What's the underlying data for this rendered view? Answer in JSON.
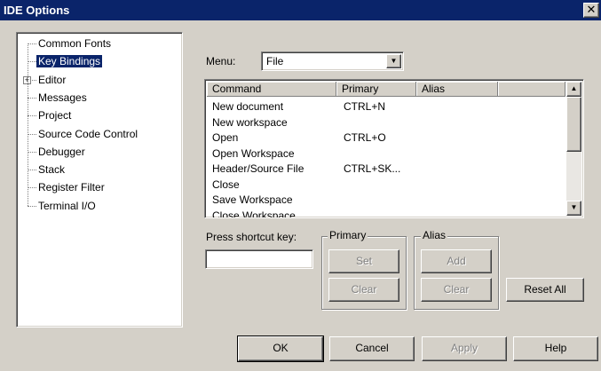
{
  "window": {
    "title": "IDE Options",
    "close_glyph": "✕"
  },
  "tree": {
    "items": [
      {
        "label": "Common Fonts",
        "selected": false,
        "expandable": false
      },
      {
        "label": "Key Bindings",
        "selected": true,
        "expandable": false
      },
      {
        "label": "Editor",
        "selected": false,
        "expandable": true
      },
      {
        "label": "Messages",
        "selected": false,
        "expandable": false
      },
      {
        "label": "Project",
        "selected": false,
        "expandable": false
      },
      {
        "label": "Source Code Control",
        "selected": false,
        "expandable": false
      },
      {
        "label": "Debugger",
        "selected": false,
        "expandable": false
      },
      {
        "label": "Stack",
        "selected": false,
        "expandable": false
      },
      {
        "label": "Register Filter",
        "selected": false,
        "expandable": false
      },
      {
        "label": "Terminal I/O",
        "selected": false,
        "expandable": false
      }
    ]
  },
  "menu": {
    "label": "Menu:",
    "selected": "File"
  },
  "list": {
    "columns": [
      "Command",
      "Primary",
      "Alias"
    ],
    "rows": [
      [
        "New document",
        "CTRL+N",
        ""
      ],
      [
        "New workspace",
        "",
        ""
      ],
      [
        "Open",
        "CTRL+O",
        ""
      ],
      [
        "Open Workspace",
        "",
        ""
      ],
      [
        "Header/Source File",
        "CTRL+SK...",
        ""
      ],
      [
        "Close",
        "",
        ""
      ],
      [
        "Save Workspace",
        "",
        ""
      ],
      [
        "Close Workspace",
        "",
        ""
      ]
    ]
  },
  "shortcut": {
    "label": "Press shortcut key:",
    "value": ""
  },
  "primary_group": {
    "label": "Primary",
    "set": "Set",
    "clear": "Clear"
  },
  "alias_group": {
    "label": "Alias",
    "add": "Add",
    "clear": "Clear"
  },
  "buttons": {
    "reset_all": "Reset All",
    "ok": "OK",
    "cancel": "Cancel",
    "apply": "Apply",
    "help": "Help"
  },
  "icons": {
    "tree_expand": "⊞",
    "scroll_up": "▲",
    "scroll_down": "▼",
    "combo_arrow": "▼"
  },
  "colors": {
    "title_bar": "#0a246a",
    "face": "#d4d0c8",
    "selection": "#0a246a"
  }
}
